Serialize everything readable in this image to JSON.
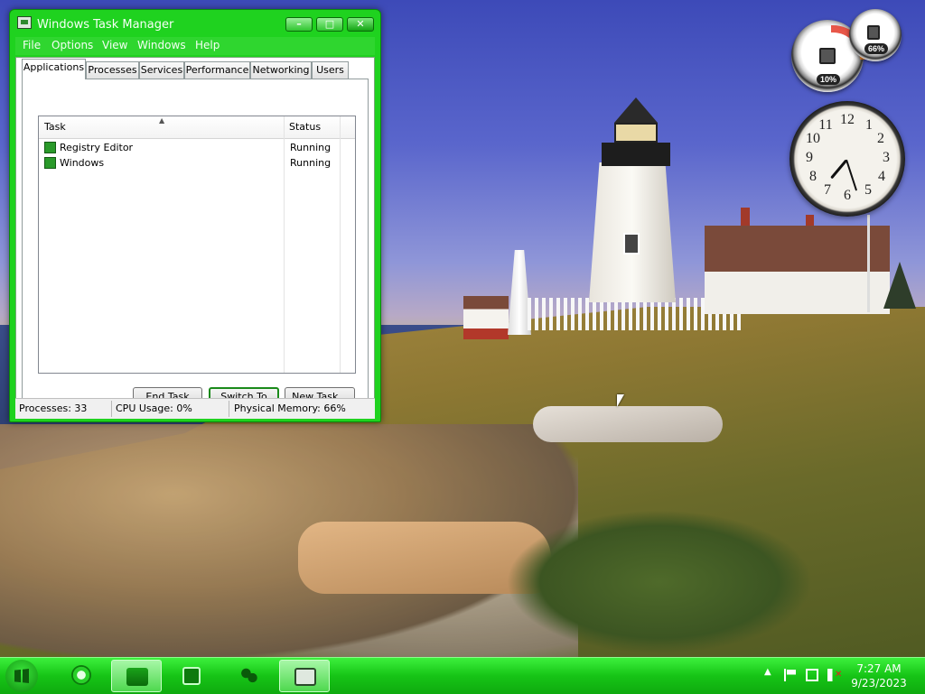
{
  "window": {
    "title": "Windows Task Manager",
    "minimize": "–",
    "maximize": "□",
    "close": "✕"
  },
  "menu": [
    "File",
    "Options",
    "View",
    "Windows",
    "Help"
  ],
  "tabs": [
    "Applications",
    "Processes",
    "Services",
    "Performance",
    "Networking",
    "Users"
  ],
  "active_tab": "Applications",
  "table": {
    "columns": [
      "Task",
      "Status"
    ],
    "rows": [
      {
        "task": "Registry Editor",
        "status": "Running",
        "icon": "registry-editor-icon"
      },
      {
        "task": "Windows",
        "status": "Running",
        "icon": "windows-app-icon"
      }
    ]
  },
  "buttons": {
    "end_task": "End Task",
    "switch_to": "Switch To",
    "new_task": "New Task..."
  },
  "status": {
    "processes": "Processes: 33",
    "cpu": "CPU Usage: 0%",
    "memory": "Physical Memory: 66%"
  },
  "gadgets": {
    "cpu_meter": "10%",
    "memory_meter": "66%",
    "clock_numbers": [
      "12",
      "1",
      "2",
      "3",
      "4",
      "5",
      "6",
      "7",
      "8",
      "9",
      "10",
      "11"
    ]
  },
  "taskbar": {
    "time": "7:27 AM",
    "date": "9/23/2023",
    "items": [
      "internet-explorer-icon",
      "file-explorer-icon",
      "media-player-icon",
      "windows-live-icon",
      "task-manager-icon"
    ]
  },
  "colors": {
    "accent": "#1fd21f",
    "taskbar": "#16c416"
  }
}
